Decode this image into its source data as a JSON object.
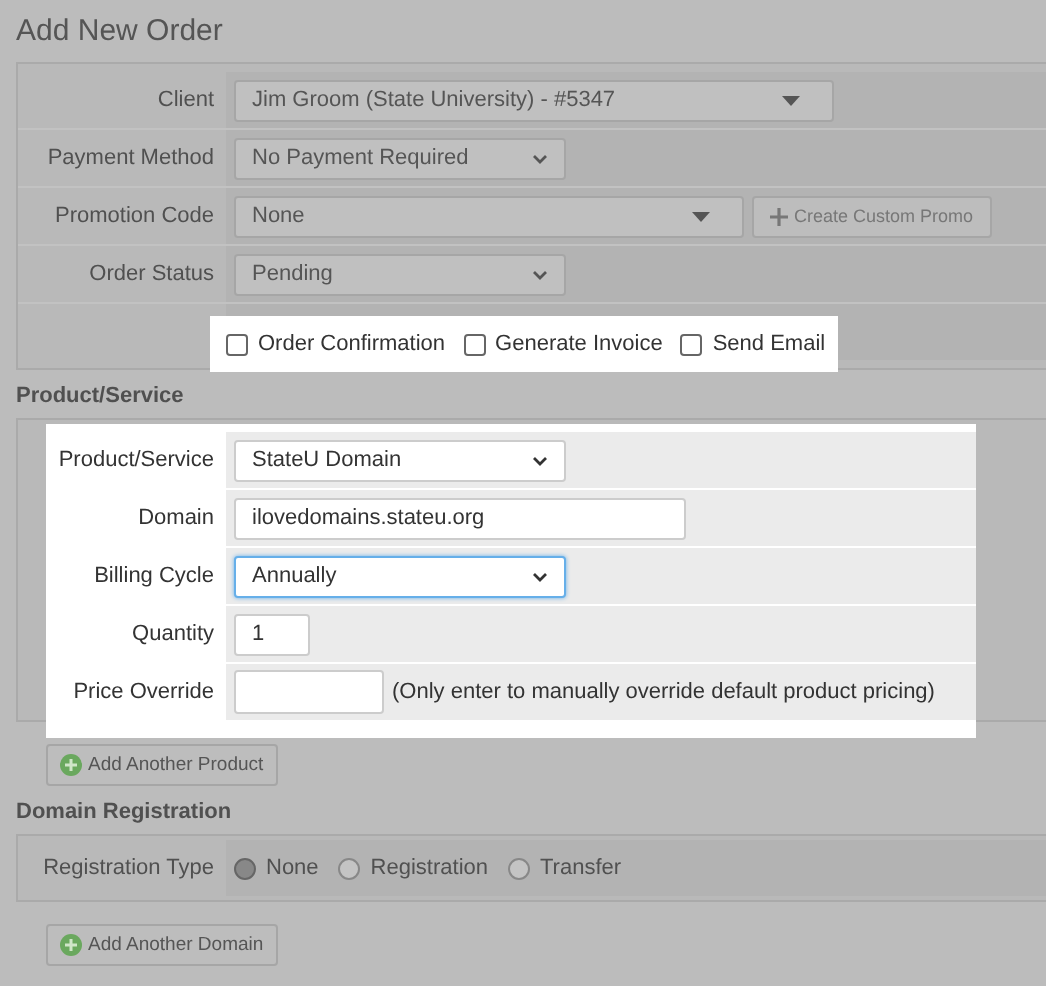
{
  "title": "Add New Order",
  "order": {
    "rows": [
      {
        "label": "Client",
        "kind": "combo",
        "value": "Jim Groom (State University) - #5347"
      },
      {
        "label": "Payment Method",
        "kind": "select",
        "value": "No Payment Required"
      },
      {
        "label": "Promotion Code",
        "kind": "combo_button",
        "value": "None",
        "button": "Create Custom Promo"
      },
      {
        "label": "Order Status",
        "kind": "select",
        "value": "Pending"
      }
    ],
    "options": [
      {
        "label": "Order Confirmation",
        "checked": false
      },
      {
        "label": "Generate Invoice",
        "checked": false
      },
      {
        "label": "Send Email",
        "checked": false
      }
    ]
  },
  "product": {
    "heading": "Product/Service",
    "rows": [
      {
        "label": "Product/Service",
        "kind": "select",
        "value": "StateU Domain",
        "focused": false
      },
      {
        "label": "Domain",
        "kind": "text",
        "value": "ilovedomains.stateu.org",
        "focused": false
      },
      {
        "label": "Billing Cycle",
        "kind": "select",
        "value": "Annually",
        "focused": true
      },
      {
        "label": "Quantity",
        "kind": "small",
        "value": "1",
        "focused": false
      },
      {
        "label": "Price Override",
        "kind": "hint",
        "hint": "(Only enter to manually override default product pricing)",
        "focused": false
      }
    ],
    "add_button": "Add Another Product"
  },
  "domain": {
    "heading": "Domain Registration",
    "label": "Registration Type",
    "options": [
      {
        "label": "None",
        "selected": true
      },
      {
        "label": "Registration",
        "selected": false
      },
      {
        "label": "Transfer",
        "selected": false
      }
    ],
    "add_button": "Add Another Domain"
  }
}
